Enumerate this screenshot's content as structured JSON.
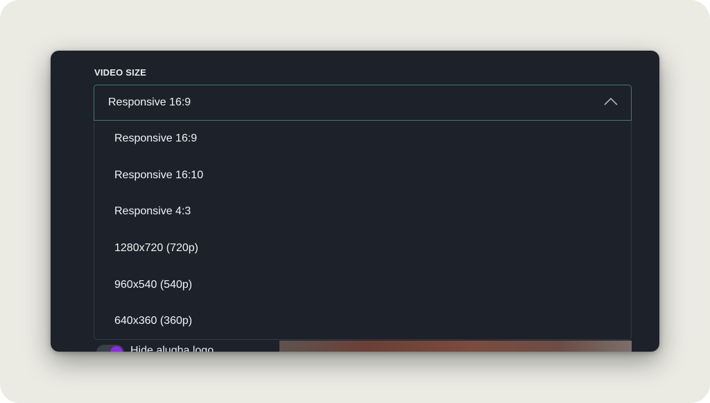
{
  "section_label": "VIDEO SIZE",
  "select": {
    "value": "Responsive 16:9",
    "expanded": true,
    "icon": "chevron-up-icon"
  },
  "options": [
    "Responsive 16:9",
    "Responsive 16:10",
    "Responsive 4:3",
    "1280x720 (720p)",
    "960x540 (540p)",
    "640x360 (360p)"
  ],
  "toggle": {
    "label": "Hide alugha logo",
    "on": true,
    "color": "#8a2ce2"
  },
  "colors": {
    "panel_background": "#1d2129",
    "page_background": "#ebebe4",
    "focus_border": "#3f7c72",
    "text": "#f1f3f5"
  }
}
